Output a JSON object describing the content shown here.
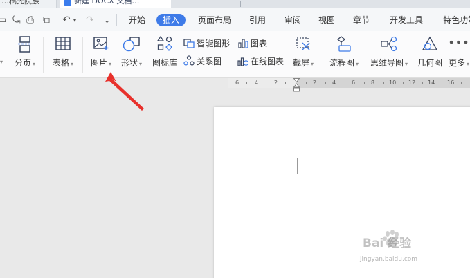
{
  "title_tabs": {
    "left_tab_label": "…稿先院族",
    "active_tab_label": "新建 DOCX 文档…"
  },
  "menu": {
    "items": [
      {
        "label": "开始"
      },
      {
        "label": "插入"
      },
      {
        "label": "页面布局"
      },
      {
        "label": "引用"
      },
      {
        "label": "审阅"
      },
      {
        "label": "视图"
      },
      {
        "label": "章节"
      },
      {
        "label": "开发工具"
      },
      {
        "label": "特色功能"
      }
    ],
    "active": "插入"
  },
  "ribbon": {
    "page_break": "分页",
    "table": "表格",
    "picture": "图片",
    "shape": "形状",
    "icon_lib": "图标库",
    "smart_art": "智能图形",
    "relation": "关系图",
    "chart": "图表",
    "online_chart": "在线图表",
    "screenshot": "截屏",
    "flowchart": "流程图",
    "mindmap": "思维导图",
    "geometry": "几何图",
    "more": "更多"
  },
  "ruler": {
    "ticks": [
      "6",
      "4",
      "2",
      "2",
      "4",
      "6",
      "8",
      "10",
      "12",
      "14",
      "16"
    ]
  },
  "watermark": {
    "brand": "Bai 经验",
    "url": "jingyan.baidu.com"
  },
  "colors": {
    "accent": "#3e7be8",
    "arrow": "#e8312c"
  }
}
